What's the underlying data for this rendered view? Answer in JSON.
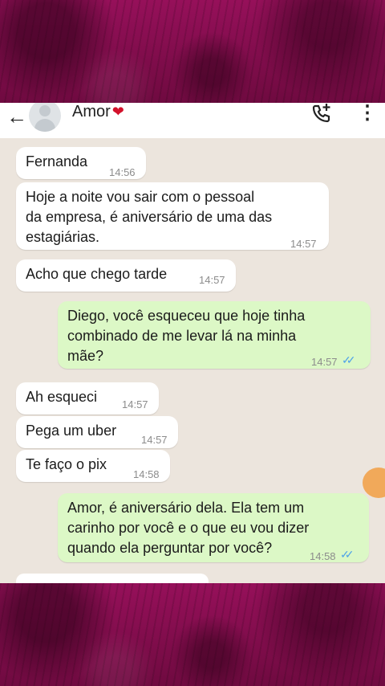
{
  "header": {
    "contact_name": "Amor",
    "heart": "❤",
    "back_icon": "arrow-left-icon",
    "call_icon": "add-call-icon",
    "menu_icon": "more-vert-icon"
  },
  "messages": [
    {
      "dir": "in",
      "text": "Fernanda",
      "time": "14:56"
    },
    {
      "dir": "in",
      "text": "Hoje a noite vou sair com o pessoal\nda empresa, é aniversário de uma das\nestagiárias.",
      "time": "14:57"
    },
    {
      "dir": "in",
      "text": "Acho que chego tarde",
      "time": "14:57"
    },
    {
      "dir": "out",
      "text": "Diego, você esqueceu que hoje tinha\ncombinado de me levar lá na minha\nmãe?",
      "time": "14:57",
      "read": true
    },
    {
      "dir": "in",
      "text": "Ah esqueci",
      "time": "14:57"
    },
    {
      "dir": "in",
      "text": "Pega um uber",
      "time": "14:57"
    },
    {
      "dir": "in",
      "text": "Te faço o pix",
      "time": "14:58"
    },
    {
      "dir": "out",
      "text": "Amor, é aniversário dela. Ela tem um\ncarinho por você e o que eu vou dizer\nquando ela perguntar por você?",
      "time": "14:58",
      "read": true
    }
  ],
  "colors": {
    "band": "#8a0d4f",
    "chat_bg": "#ece5dd",
    "incoming": "#ffffff",
    "outgoing": "#dcf8c6",
    "read_ticks": "#4fa3e8"
  }
}
